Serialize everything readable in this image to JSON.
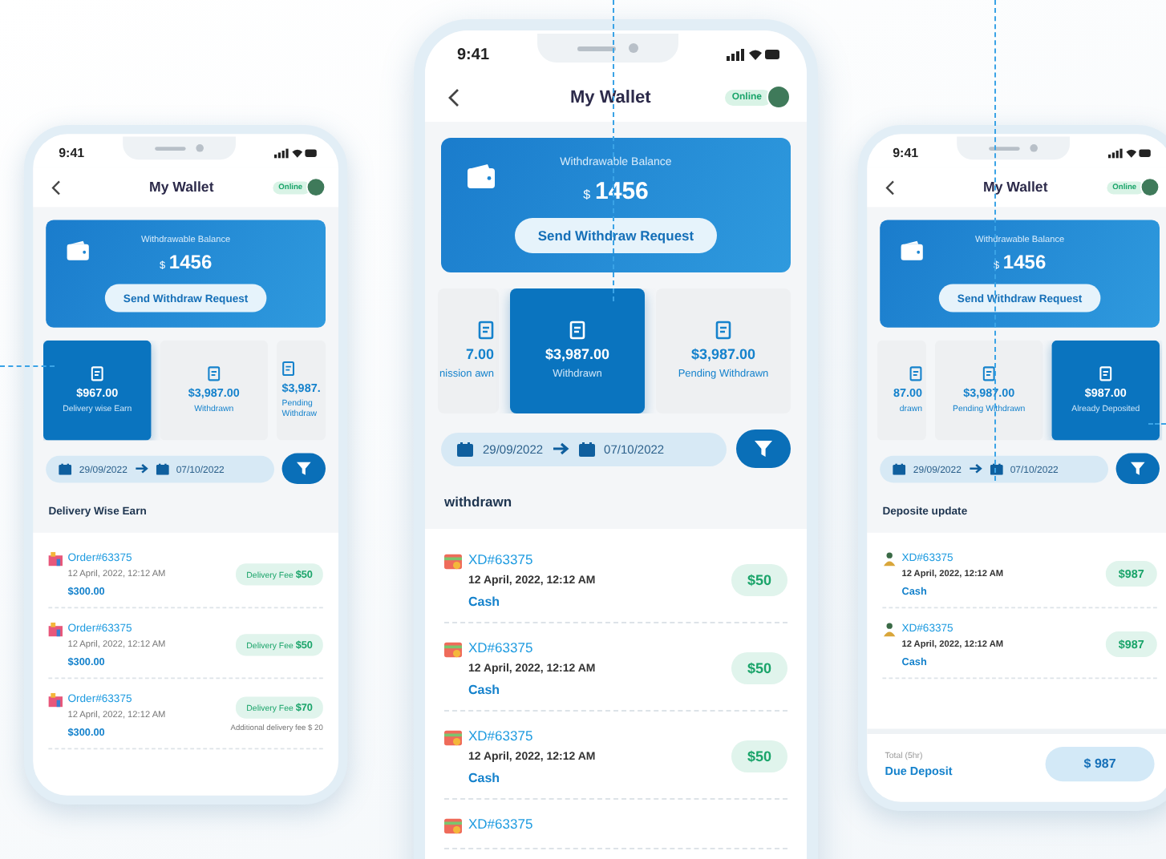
{
  "phones": [
    {
      "time": "9:41",
      "title": "My Wallet",
      "status": "Online",
      "balance": {
        "label": "Withdrawable Balance",
        "currency": "$",
        "amount": "1456",
        "button": "Send Withdraw Request"
      },
      "cards": [
        {
          "value": "$967.00",
          "label": "Delivery wise Earn",
          "selected": true,
          "kind": "full"
        },
        {
          "value": "$3,987.00",
          "label": "Withdrawn",
          "selected": false,
          "kind": "full"
        },
        {
          "value": "$3,987.",
          "label": "Pending Withdraw",
          "selected": false,
          "kind": "cutright"
        }
      ],
      "date_range": {
        "from": "29/09/2022",
        "to": "07/10/2022"
      },
      "section_title": "Delivery Wise Earn",
      "rows": [
        {
          "kind": "order",
          "id": "Order#63375",
          "date": "12 April, 2022, 12:12 AM",
          "amount": "$300.00",
          "fee": "Delivery Fee **$50**"
        },
        {
          "kind": "order",
          "id": "Order#63375",
          "date": "12 April, 2022, 12:12 AM",
          "amount": "$300.00",
          "fee": "Delivery Fee **$50**"
        },
        {
          "kind": "order",
          "id": "Order#63375",
          "date": "12 April, 2022, 12:12 AM",
          "amount": "$300.00",
          "fee": "Delivery Fee **$70**",
          "note": "Additional delivery fee $ 20"
        }
      ]
    },
    {
      "time": "9:41",
      "title": "My Wallet",
      "status": "Online",
      "balance": {
        "label": "Withdrawable Balance",
        "currency": "$",
        "amount": "1456",
        "button": "Send Withdraw Request"
      },
      "cards": [
        {
          "value": "7.00",
          "label": "nission awn",
          "selected": false,
          "kind": "cutleft"
        },
        {
          "value": "$3,987.00",
          "label": "Withdrawn",
          "selected": true,
          "kind": "full"
        },
        {
          "value": "$3,987.00",
          "label": "Pending Withdrawn",
          "selected": false,
          "kind": "full"
        }
      ],
      "date_range": {
        "from": "29/09/2022",
        "to": "07/10/2022"
      },
      "section_title": "withdrawn",
      "rows": [
        {
          "kind": "transaction",
          "id": "XD#63375",
          "date": "12 April, 2022, 12:12 AM",
          "method": "Cash",
          "amount": "$50"
        },
        {
          "kind": "transaction",
          "id": "XD#63375",
          "date": "12 April, 2022, 12:12 AM",
          "method": "Cash",
          "amount": "$50"
        },
        {
          "kind": "transaction",
          "id": "XD#63375",
          "date": "12 April, 2022, 12:12 AM",
          "method": "Cash",
          "amount": "$50"
        },
        {
          "kind": "transaction",
          "id": "XD#63375"
        }
      ]
    },
    {
      "time": "9:41",
      "title": "My Wallet",
      "status": "Online",
      "balance": {
        "label": "Withdrawable Balance",
        "currency": "$",
        "amount": "1456",
        "button": "Send Withdraw Request"
      },
      "cards": [
        {
          "value": "87.00",
          "label": "drawn",
          "selected": false,
          "kind": "cutleft"
        },
        {
          "value": "$3,987.00",
          "label": "Pending Withdrawn",
          "selected": false,
          "kind": "full"
        },
        {
          "value": "$987.00",
          "label": "Already Deposited",
          "selected": true,
          "kind": "full"
        }
      ],
      "date_range": {
        "from": "29/09/2022",
        "to": "07/10/2022"
      },
      "section_title": "Deposite update",
      "rows": [
        {
          "kind": "deposit",
          "id": "XD#63375",
          "date": "12 April, 2022, 12:12 AM",
          "method": "Cash",
          "amount": "$987"
        },
        {
          "kind": "deposit",
          "id": "XD#63375",
          "date": "12 April, 2022, 12:12 AM",
          "method": "Cash",
          "amount": "$987"
        }
      ],
      "footer": {
        "caption": "Total (5hr)",
        "label": "Due Deposit",
        "button": "$ 987"
      }
    }
  ]
}
